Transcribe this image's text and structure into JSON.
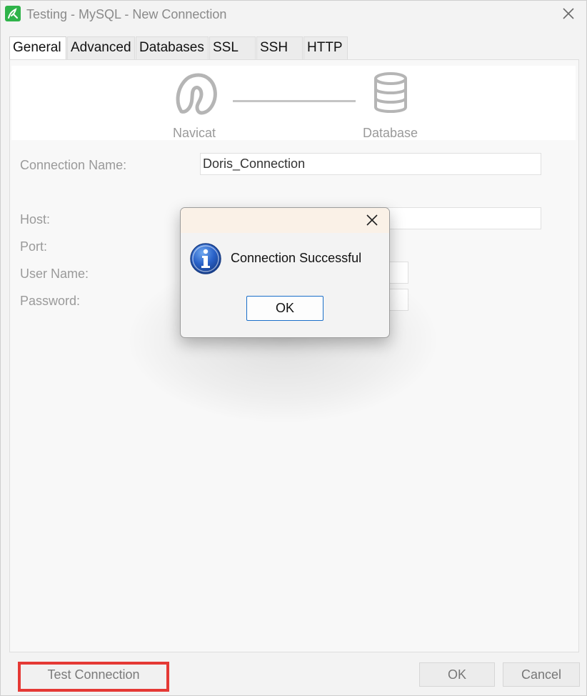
{
  "window": {
    "title": "Testing - MySQL - New Connection"
  },
  "tabs": [
    {
      "label": "General",
      "active": true
    },
    {
      "label": "Advanced",
      "active": false
    },
    {
      "label": "Databases",
      "active": false
    },
    {
      "label": "SSL",
      "active": false
    },
    {
      "label": "SSH",
      "active": false
    },
    {
      "label": "HTTP",
      "active": false
    }
  ],
  "banner": {
    "left_label": "Navicat",
    "right_label": "Database",
    "left_icon": "navicat-logo-icon",
    "right_icon": "database-icon"
  },
  "form": {
    "connection_name_label": "Connection Name:",
    "connection_name_value": "Doris_Connection",
    "host_label": "Host:",
    "port_label": "Port:",
    "user_name_label": "User Name:",
    "password_label": "Password:"
  },
  "buttons": {
    "test_connection": "Test Connection",
    "ok": "OK",
    "cancel": "Cancel"
  },
  "dialog": {
    "message": "Connection Successful",
    "ok": "OK",
    "icon": "info-icon"
  },
  "colors": {
    "highlight_border": "#e53935",
    "app_icon": "#2fb34a",
    "dialog_title_bg": "#faf1e7",
    "dialog_button_border": "#1a6fc9"
  }
}
